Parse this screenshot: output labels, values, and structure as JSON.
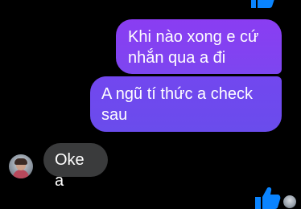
{
  "colors": {
    "background": "#000000",
    "sent_bubble_top": "#8a3df2",
    "sent_bubble_bottom": "#6a4cec",
    "received_bubble": "#3a3b3c",
    "like_blue": "#0a84ff",
    "text": "#ffffff"
  },
  "messages": [
    {
      "direction": "outgoing",
      "text": "Khi nào xong e cứ\nnhắn qua a đi"
    },
    {
      "direction": "outgoing",
      "text": "A ngũ tí thức a check\nsau"
    },
    {
      "direction": "incoming",
      "text": "Oke a"
    }
  ],
  "icons": {
    "like": "thumbs-up-icon",
    "avatar": "contact-avatar",
    "seen": "seen-avatar"
  }
}
